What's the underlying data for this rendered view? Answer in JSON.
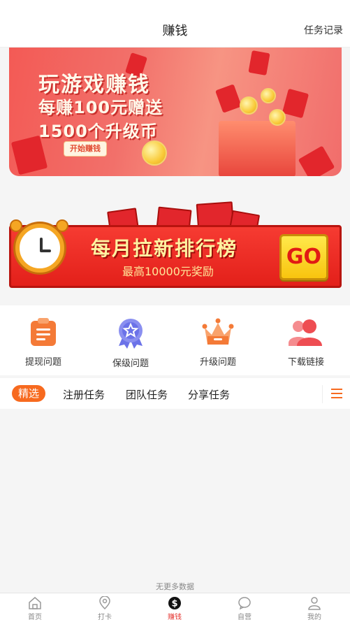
{
  "header": {
    "title": "赚钱",
    "link": "任务记录"
  },
  "banner1": {
    "line1": "玩游戏赚钱",
    "line2": "每赚100元赠送",
    "line3": "1500个升级币",
    "button": "开始赚钱"
  },
  "banner2": {
    "title": "每月拉新排行榜",
    "subtitle": "最高10000元奖励",
    "go": "GO"
  },
  "icons": [
    {
      "label": "提现问题",
      "icon": "clipboard-icon",
      "color": "#f47a37"
    },
    {
      "label": "保级问题",
      "icon": "badge-icon",
      "color": "#6b72e8"
    },
    {
      "label": "升级问题",
      "icon": "crown-icon",
      "color": "#f47a37"
    },
    {
      "label": "下载链接",
      "icon": "users-icon",
      "color": "#ee4d52"
    }
  ],
  "tabs": [
    "精选",
    "注册任务",
    "团队任务",
    "分享任务"
  ],
  "empty_text": "无更多数据",
  "tabbar": [
    {
      "label": "首页",
      "icon": "home-icon"
    },
    {
      "label": "打卡",
      "icon": "location-icon"
    },
    {
      "label": "赚钱",
      "icon": "dollar-icon"
    },
    {
      "label": "自营",
      "icon": "chat-icon"
    },
    {
      "label": "我的",
      "icon": "user-icon"
    }
  ],
  "colors": {
    "accent": "#f76a1f",
    "active_tab": "#e53935"
  }
}
